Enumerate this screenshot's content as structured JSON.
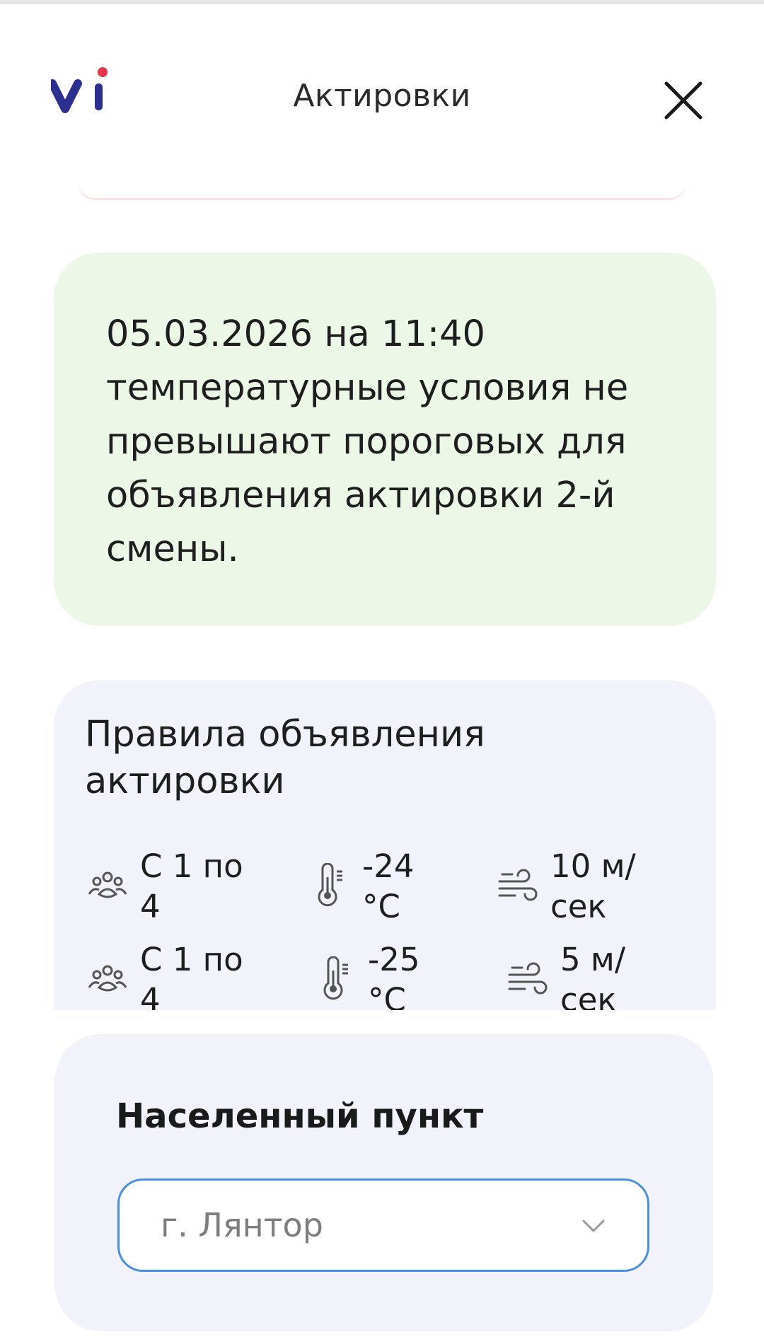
{
  "header": {
    "logo_text": "vi",
    "title": "Актировки",
    "close_icon": "close-icon"
  },
  "status": {
    "message": "05.03.2026 на 11:40 температурные условия не превышают пороговых для объявления актировки 2-й смены.",
    "background_color": "#edf7e8"
  },
  "rules": {
    "title": "Правила объявления актировки",
    "rows": [
      {
        "grades": "С 1 по\n4",
        "temperature": "-24\n°C",
        "wind": "10 м/\nсек"
      },
      {
        "grades": "С 1 по\n4",
        "temperature": "-25\n°C",
        "wind": "5 м/\nсек"
      }
    ],
    "icons": {
      "grades": "people-group-icon",
      "temperature": "thermometer-icon",
      "wind": "wind-icon"
    }
  },
  "settlement": {
    "label": "Населенный пункт",
    "selected": "г. Лянтор",
    "accent_color": "#4a90e2"
  },
  "colors": {
    "brand_blue": "#2b2f8f",
    "brand_red": "#e8344a"
  }
}
